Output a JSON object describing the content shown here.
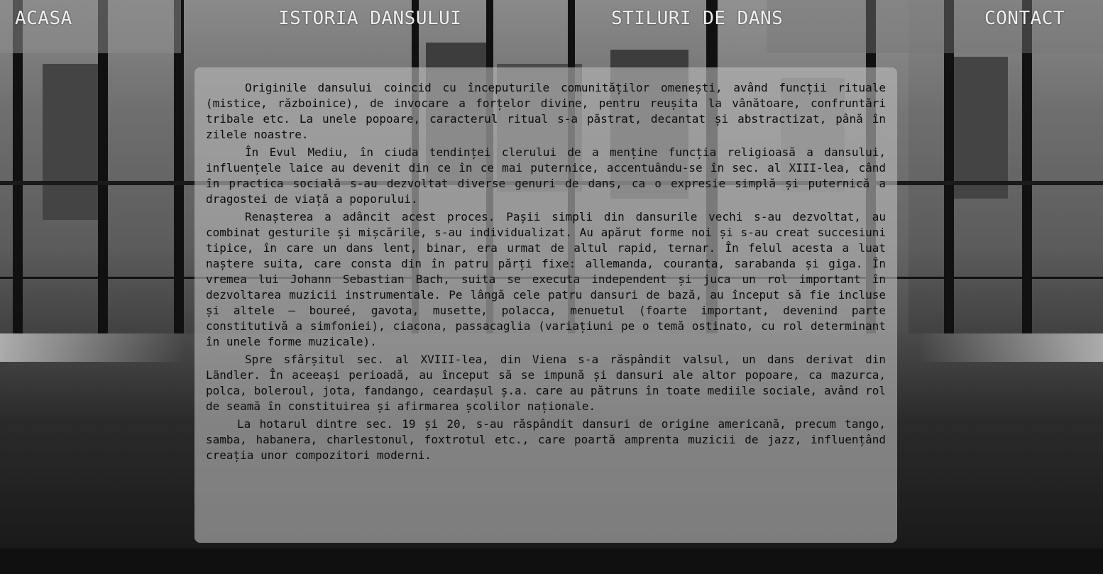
{
  "nav": {
    "acasa": "ACASA",
    "istoria": "ISTORIA DANSULUI",
    "stiluri": "STILURI DE DANS",
    "contact": "CONTACT"
  },
  "article": {
    "paragraphs": [
      "Originile dansului coincid cu începuturile comunităților omenești, având funcții rituale (mistice, războinice), de invocare a forțelor divine, pentru reușita la vânătoare, confruntări tribale etc. La unele popoare, caracterul ritual s-a păstrat, decantat și abstractizat, până în zilele noastre.",
      "În Evul Mediu, în ciuda tendinței clerului de a menține funcția religioasă a dansului, influențele laice au devenit din ce în ce mai puternice, accentuându-se în sec. al XIII-lea, când în practica socială s-au dezvoltat diverse genuri de dans, ca o expresie simplă și puternică a dragostei de viață a poporului.",
      "Renașterea a adâncit acest proces. Pașii simpli din dansurile vechi s-au dezvoltat, au combinat gesturile și mișcările, s-au individualizat. Au apărut forme noi și s-au creat succesiuni tipice, în care un dans lent, binar, era urmat de altul rapid, ternar. În felul acesta a luat naștere suita, care consta din în patru părți fixe: allemanda, couranta, sarabanda și giga. În vremea lui Johann Sebastian Bach, suita se executa independent și juca un rol important în dezvoltarea muzicii instrumentale. Pe lângă cele patru dansuri de bază, au început să fie incluse și altele – boureé, gavota, musette, polacca, menuetul (foarte important, devenind parte constitutivă a simfoniei), ciacona, passacaglia (variațiuni pe o temă ostinato, cu rol determinant în unele forme muzicale).",
      "Spre sfârșitul sec. al XVIII-lea, din Viena s-a răspândit valsul, un dans derivat din Ländler. În aceeași perioadă, au început să se impună și dansuri ale altor popoare, ca mazurca, polca, boleroul, jota, fandango, ceardașul ș.a. care au pătruns în toate mediile sociale, având rol de seamă în constituirea și afirmarea școlilor naționale.",
      "La hotarul dintre sec. 19 și 20, s-au răspândit dansuri de origine americană, precum tango, samba, habanera, charlestonul, foxtrotul etc., care poartă amprenta muzicii de jazz, influențând creația unor compozitori moderni."
    ]
  }
}
